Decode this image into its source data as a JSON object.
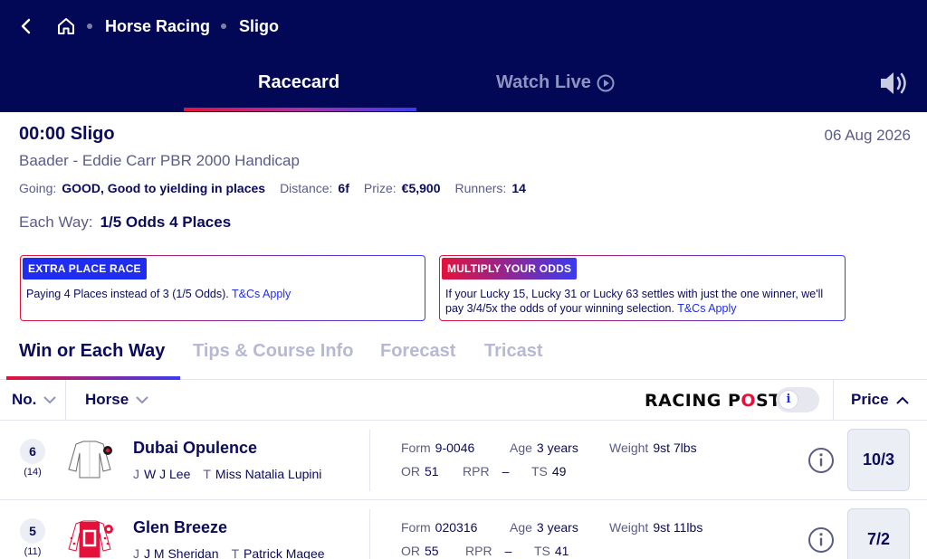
{
  "breadcrumb": {
    "items": [
      "Horse Racing",
      "Sligo"
    ]
  },
  "tabs": {
    "racecard": "Racecard",
    "watch_live": "Watch Live"
  },
  "race": {
    "title": "00:00 Sligo",
    "date": "06 Aug 2026",
    "name": "Baader - Eddie Carr PBR 2000 Handicap",
    "going_label": "Going:",
    "going": "GOOD, Good to yielding in places",
    "distance_label": "Distance:",
    "distance": "6f",
    "prize_label": "Prize:",
    "prize": "€5,900",
    "runners_label": "Runners:",
    "runners": "14",
    "each_way_label": "Each Way:",
    "each_way": "1/5 Odds 4 Places"
  },
  "promos": [
    {
      "badge": "EXTRA PLACE RACE",
      "text": "Paying 4 Places instead of 3 (1/5 Odds).",
      "link": "T&Cs Apply"
    },
    {
      "badge": "MULTIPLY YOUR ODDS",
      "text": "If your Lucky 15, Lucky 31 or Lucky 63 settles with just the one winner, we'll pay 3/4/5x the odds of your winning selection.",
      "link": "T&Cs Apply"
    }
  ],
  "subtabs": [
    "Win or Each Way",
    "Tips & Course Info",
    "Forecast",
    "Tricast"
  ],
  "columns": {
    "no": "No.",
    "horse": "Horse",
    "racing_post_logo": "RACING POST",
    "toggle_icon": "i",
    "price": "Price"
  },
  "runners": [
    {
      "number": "6",
      "draw": "(14)",
      "name": "Dubai Opulence",
      "jockey_label": "J",
      "jockey": "W J Lee",
      "trainer_label": "T",
      "trainer": "Miss Natalia Lupini",
      "form_label": "Form",
      "form": "9-0046",
      "age_label": "Age",
      "age": "3 years",
      "weight_label": "Weight",
      "weight": "9st 7lbs",
      "or_label": "OR",
      "or": "51",
      "rpr_label": "RPR",
      "rpr": "–",
      "ts_label": "TS",
      "ts": "49",
      "price": "10/3",
      "silks": {
        "body": "#ffffff",
        "sleeves": "#ffffff",
        "cap": "#1a1a1a",
        "accent": "#e4123a"
      }
    },
    {
      "number": "5",
      "draw": "(11)",
      "name": "Glen Breeze",
      "jockey_label": "J",
      "jockey": "J M Sheridan",
      "trainer_label": "T",
      "trainer": "Patrick Magee",
      "form_label": "Form",
      "form": "020316",
      "age_label": "Age",
      "age": "3 years",
      "weight_label": "Weight",
      "weight": "9st 11lbs",
      "or_label": "OR",
      "or": "55",
      "rpr_label": "RPR",
      "rpr": "–",
      "ts_label": "TS",
      "ts": "41",
      "price": "7/2",
      "silks": {
        "body": "#e4123a",
        "sleeves": "#ffffff",
        "cap": "#e4123a",
        "accent": "#ffffff"
      }
    }
  ],
  "colors": {
    "header_bg": "#020855",
    "accent_red": "#e4123a",
    "accent_blue": "#3b3bf0",
    "text_primary": "#0b0b5c",
    "text_muted": "#5a5c86"
  }
}
